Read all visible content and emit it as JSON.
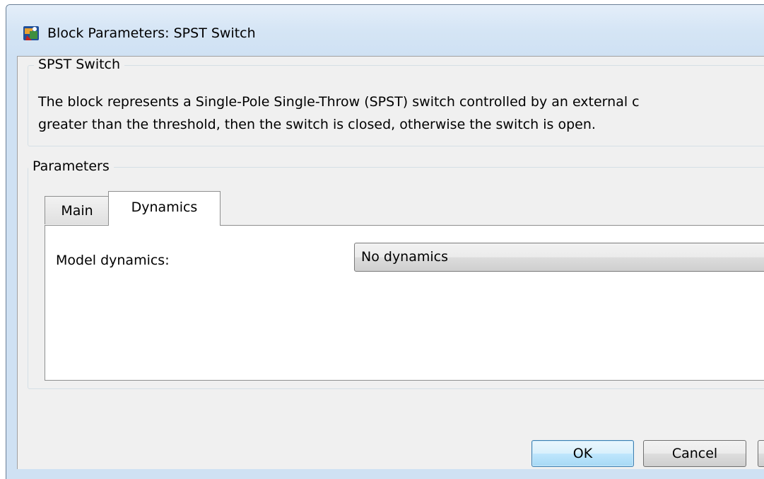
{
  "window": {
    "title": "Block Parameters: SPST Switch",
    "icon": "simulink-block-icon"
  },
  "description_group": {
    "legend": "SPST Switch",
    "lines": [
      "The block represents a Single-Pole Single-Throw (SPST) switch controlled by an external c",
      "greater than the threshold, then the switch is closed, otherwise the switch is open."
    ]
  },
  "parameters_group": {
    "legend": "Parameters",
    "tabs": [
      {
        "label": "Main",
        "selected": false
      },
      {
        "label": "Dynamics",
        "selected": true
      }
    ],
    "fields": [
      {
        "label": "Model dynamics:",
        "value": "No dynamics"
      }
    ]
  },
  "buttons": {
    "ok": "OK",
    "cancel": "Cancel"
  },
  "colors": {
    "title_bar": "#cfe1f3",
    "client_background": "#f0f0f0",
    "default_button_border": "#3c7fb1"
  }
}
